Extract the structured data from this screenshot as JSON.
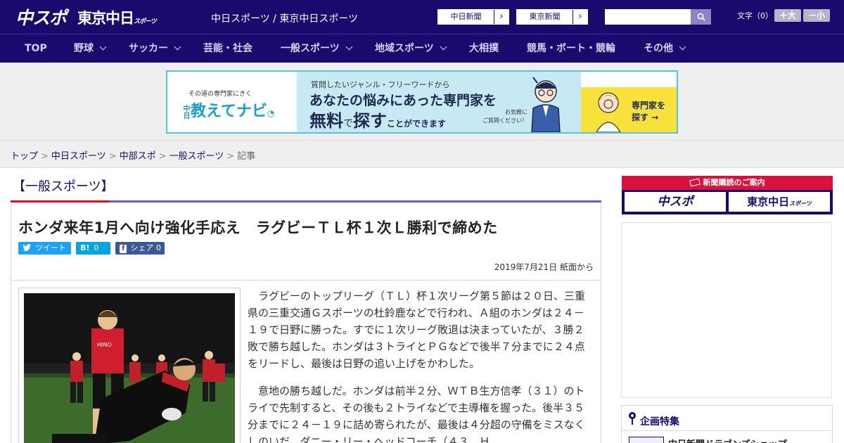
{
  "header": {
    "logo_chuspo": "中スポ",
    "logo_tokyo": "東京中日",
    "logo_tokyo_suffix": "スポーツ",
    "site_title": "中日スポーツ / 東京中日スポーツ",
    "paper_links": [
      {
        "label": "中日新聞",
        "arrow": "›"
      },
      {
        "label": "東京新聞",
        "arrow": "›"
      }
    ],
    "search": {
      "value": "",
      "placeholder": ""
    },
    "font_size_label": "文字（0）",
    "font_larger": "＋大",
    "font_smaller": "－小"
  },
  "nav": {
    "items": [
      {
        "label": "TOP"
      },
      {
        "label": "野球"
      },
      {
        "label": "サッカー"
      },
      {
        "label": "芸能・社会"
      },
      {
        "label": "一般スポーツ"
      },
      {
        "label": "地域スポーツ"
      },
      {
        "label": "大相撲"
      },
      {
        "label": "競馬・ボート・競輪"
      },
      {
        "label": "その他"
      }
    ]
  },
  "ad": {
    "left_sub": "その道の専門家にきく",
    "left_vertical": "中日",
    "left_main": "教えてナビ",
    "mid_line1": "質問したいジャンル・フリーワードから",
    "mid_line2": "あなたの悩みにあった専門家を",
    "mid_line3_a": "無料",
    "mid_line3_b": "で",
    "mid_line3_c": "探す",
    "mid_line3_d": "ことができます",
    "mid_note1": "お気軽に",
    "mid_note2": "ご質問ください！",
    "right_line1": "専門家を",
    "right_line2": "探す →"
  },
  "breadcrumb": {
    "items": [
      "トップ",
      "中日スポーツ",
      "中部スポ",
      "一般スポーツ"
    ],
    "current": "記事",
    "separator": ">"
  },
  "article": {
    "category": "【一般スポーツ】",
    "headline": "ホンダ来年1月へ向け強化手応え　ラグビーＴＬ杯１次Ｌ勝利で締めた",
    "share": {
      "tweet": "ツイート",
      "hatena_icon": "B!",
      "hatena_count": "0",
      "facebook_icon": "f",
      "facebook_label": "シェア",
      "facebook_count": "0"
    },
    "date": "2019年7月21日 紙面から",
    "paragraphs": [
      "ラグビーのトップリーグ（ＴＬ）杯１次リーグ第５節は２０日、三重県の三重交通Ｇスポーツの杜鈴鹿などで行われ、Ａ組のホンダは２４－１９で日野に勝った。すでに１次リーグ敗退は決まっていたが、３勝２敗で勝ち越した。ホンダは３トライとＰＧなどで後半７分までに２４点をリードし、最後は日野の追い上げをかわした。",
      "意地の勝ち越しだ。ホンダは前半２分、ＷＴＢ生方信孝（３１）のトライで先制すると、その後も２トライなどで主導権を握った。後半３５分までに２４－１９に詰め寄られたが、最後は４分超の守備をミスなくしのいだ。ダニー・リー・ヘッドコーチ（４３、Ｈ"
    ]
  },
  "sidebar": {
    "subscribe_title": "新聞購読のご案内",
    "subscribe_chuspo": "中スポ",
    "subscribe_tokyo": "東京中日",
    "subscribe_tokyo_suffix": "スポーツ",
    "feature_title": "企画特集",
    "feature_item": "中日新聞ドラゴンズショップ"
  },
  "colors": {
    "brand_navy": "#1a0a6e",
    "accent_red": "#d4111e",
    "twitter": "#1da1f2",
    "hatena": "#00a4de",
    "facebook": "#3b5998"
  }
}
